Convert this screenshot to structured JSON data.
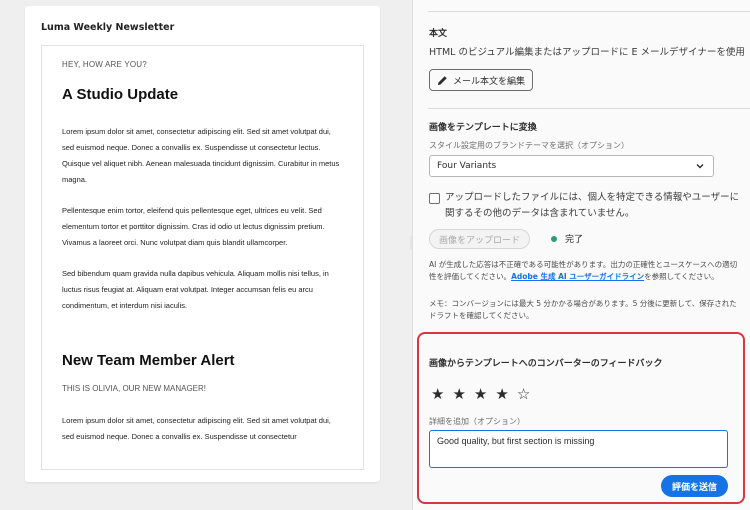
{
  "preview": {
    "title": "Luma Weekly Newsletter",
    "eyebrow": "HEY, HOW ARE YOU?",
    "heading1": "A Studio Update",
    "para1": "Lorem ipsum dolor sit amet, consectetur adipiscing elit. Sed sit amet volutpat dui, sed euismod neque. Donec a convallis ex. Suspendisse ut consectetur lectus. Quisque vel aliquet nibh. Aenean malesuada tincidunt dignissim. Curabitur in metus magna.",
    "para2": "Pellentesque enim tortor, eleifend quis pellentesque eget, ultrices eu velit. Sed elementum tortor et porttitor dignissim. Cras id odio ut lectus dignissim pretium. Vivamus a laoreet orci. Nunc volutpat diam quis blandit ullamcorper.",
    "para3": "Sed bibendum quam gravida nulla dapibus vehicula. Aliquam mollis nisi tellus, in luctus risus feugiat at. Aliquam erat volutpat. Integer accumsan felis eu arcu condimentum, et interdum nisi iaculis.",
    "heading2": "New Team Member Alert",
    "eyebrow2": "THIS IS OLIVIA, OUR NEW MANAGER!",
    "para4": "Lorem ipsum dolor sit amet, consectetur adipiscing elit. Sed sit amet volutpat dui, sed euismod neque. Donec a convallis ex. Suspendisse ut consectetur"
  },
  "body_section": {
    "heading": "本文",
    "description": "HTML のビジュアル編集またはアップロードに E メールデザイナーを使用",
    "edit_button": "メール本文を編集"
  },
  "convert_section": {
    "heading": "画像をテンプレートに変換",
    "theme_label": "スタイル設定用のブランドテーマを選択（オプション）",
    "theme_value": "Four Variants",
    "consent_text": "アップロードしたファイルには、個人を特定できる情報やユーザーに関するその他のデータは含まれていません。",
    "upload_button": "画像をアップロード",
    "status": "完了",
    "notice_pre": "AI が生成した応答は不正確である可能性があります。出力の正確性とユースケースへの適切性を評価してください。",
    "notice_link": "Adobe 生成 AI ユーザーガイドライン",
    "notice_post": "を参照してください。",
    "memo": "メモ：コンバージョンには最大 5 分かかる場合があります。5 分後に更新して、保存されたドラフトを確認してください。"
  },
  "feedback": {
    "heading": "画像からテンプレートへのコンバーターのフィードバック",
    "rating": 4,
    "max_rating": 5,
    "filled_star": "★",
    "empty_star": "☆",
    "details_label": "詳細を追加（オプション）",
    "details_value": "Good quality, but first section is missing",
    "submit_button": "評価を送信"
  },
  "colors": {
    "accent": "#1473e6",
    "highlight_border": "#d7373f",
    "status_ok": "#2d9d78"
  }
}
